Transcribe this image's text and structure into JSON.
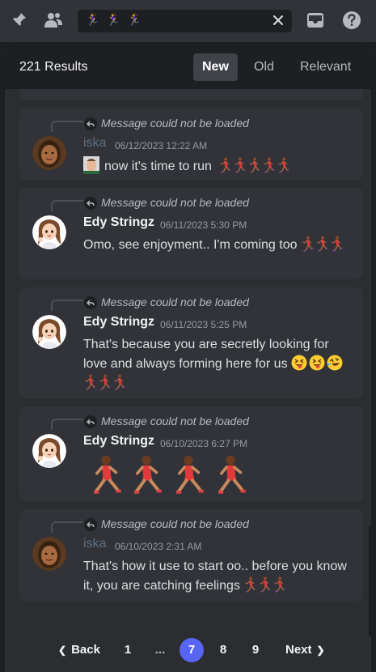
{
  "toolbar": {
    "icons": [
      "pin-icon",
      "members-icon",
      "inbox-icon",
      "help-icon"
    ],
    "search": {
      "value": "🏃‍♀️ 🏃‍♀️ 🏃‍♀️",
      "clear_icon": "close-icon"
    }
  },
  "results": {
    "count_label": "221 Results",
    "sort": {
      "new": "New",
      "old": "Old",
      "relevant": "Relevant",
      "selected": "New"
    }
  },
  "messages": [
    {
      "reply": "Message could not be loaded",
      "author": "iska",
      "timestamp": "06/12/2023 12:22 AM",
      "text": "now it's time to run",
      "emoji_count": 5
    },
    {
      "reply": "Message could not be loaded",
      "author": "Edy Stringz",
      "timestamp": "06/11/2023 5:30 PM",
      "text": "Omo, see enjoyment.. I'm coming too"
    },
    {
      "reply": "Message could not be loaded",
      "author": "Edy Stringz",
      "timestamp": "06/11/2023 5:25 PM",
      "text": "That's because you are secretly looking for love and always forming here for us"
    },
    {
      "reply": "Message could not be loaded",
      "author": "Edy Stringz",
      "timestamp": "06/10/2023 6:27 PM",
      "big_emoji_count": 4
    },
    {
      "reply": "Message could not be loaded",
      "author": "iska",
      "timestamp": "06/10/2023 2:31 AM",
      "text": "That's how it use to start oo.. before you know it, you are catching feelings"
    }
  ],
  "pagination": {
    "back": "Back",
    "pages": [
      "1",
      "...",
      "7",
      "8",
      "9"
    ],
    "current": "7",
    "next": "Next"
  },
  "colors": {
    "accent": "#5865f2",
    "background": "#1e1f22",
    "card": "#313338",
    "panel": "#2b2d31"
  }
}
